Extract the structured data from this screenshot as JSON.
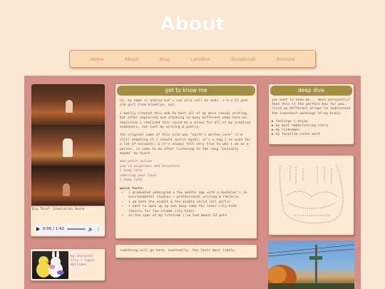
{
  "page": {
    "title": "About"
  },
  "nav": {
    "items": [
      "Home",
      "About",
      "Blog",
      "Landline",
      "Scrapbook",
      "Armoire"
    ]
  },
  "audio": {
    "caption": "Big Thief- Simulation Swarm",
    "time": "0:00 / 1:42"
  },
  "plush": {
    "caption_lines": [
      "my children:",
      "tily + lapin",
      "#plrimen"
    ]
  },
  "get_to_know_me": {
    "title": "get to know me",
    "intro": "hi, my name is andrea but u can also call me andi. i'm a 22 year old girl from brooklyn, nyc.",
    "para2": "i mainly created this web to host all of my more casual writing. but after exploring and stalking so many different webs here on neocities i realized this could be a place for all of my creative endeavors, not just my writing & poetry.",
    "para3": "the original name of this site was \"earth's molten core\" (i'm still debating if i should switch back), it's a tag i've used for a lot of accounts, & it's always felt very true to who i am as a person. it came to me after listening to the song \"possibly maybe\" by bjork",
    "lyrics": [
      "mon petit vulcan",
      "you're eruptions and disasters",
      "i keep calm",
      "admiring your lava",
      "i keep calm"
    ],
    "facts_label": "quick facts:",
    "facts": [
      "i graduated undergrad a few months ago with a bachelor's in environmental studies + professional writing & rhetoric",
      "i am both the oldest & the middle child (all girls)",
      "i want to open up my own away camp for inner city kids (mainly for low-income city kids)",
      "in the span of my lifetime i've had about 13 pets"
    ]
  },
  "note": {
    "text": "something will go here, eventually. fun facts most likely."
  },
  "deep_dive": {
    "title": "deep dive",
    "intro": "you want to know me... more personally? then this is the perfect box for you. click on different arrows to understand the innermost workings of my brain.",
    "links": [
      "▶ feelings i enjoy",
      "▶ my most embarrassing story",
      "▶ my nicknames",
      "▶ my favorite curse word"
    ]
  },
  "colors": {
    "background": "#fbe8d3",
    "panel": "#d48f88",
    "header_green": "#a28f42",
    "nav_text": "#e08a6e"
  }
}
